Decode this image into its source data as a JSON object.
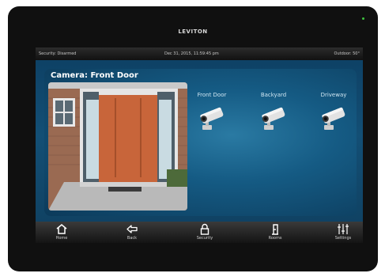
{
  "device": {
    "brand": "LEVITON"
  },
  "status_bar": {
    "security": "Security: Disarmed",
    "datetime": "Dec 31, 2015, 11:59:45 pm",
    "outdoor": "Outdoor: 50°"
  },
  "camera_panel": {
    "title": "Camera: Front Door",
    "cameras": [
      {
        "label": "Front Door",
        "icon": "security-camera-icon"
      },
      {
        "label": "Backyard",
        "icon": "security-camera-icon"
      },
      {
        "label": "Driveway",
        "icon": "security-camera-icon"
      }
    ]
  },
  "nav": {
    "items": [
      {
        "label": "Home",
        "icon": "home-icon"
      },
      {
        "label": "Back",
        "icon": "back-arrow-icon"
      },
      {
        "label": "Security",
        "icon": "lock-icon"
      },
      {
        "label": "Rooms",
        "icon": "door-icon"
      },
      {
        "label": "Settings",
        "icon": "sliders-icon"
      }
    ]
  },
  "colors": {
    "screen_background": "#134f75",
    "led": "#3ec23e",
    "nav_bar": "#2a2a2a"
  }
}
